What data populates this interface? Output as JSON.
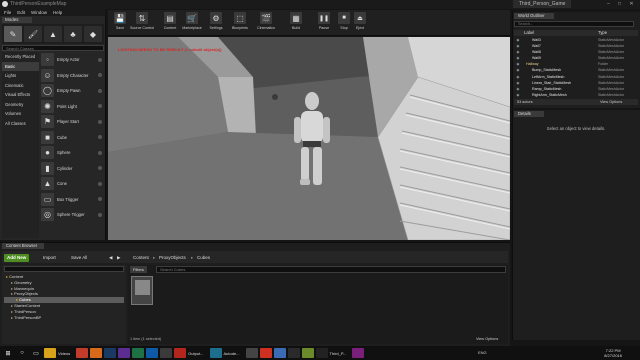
{
  "window": {
    "title": "ThirdPersonExampleMap",
    "project": "Third_Person_Game",
    "menu": [
      "File",
      "Edit",
      "Window",
      "Help"
    ]
  },
  "modes": {
    "tab_label": "Modes",
    "search_placeholder": "Search Classes",
    "icons": [
      "place-icon",
      "paint-icon",
      "landscape-icon",
      "foliage-icon",
      "geometry-icon"
    ],
    "categories": [
      "Recently Placed",
      "Basic",
      "Lights",
      "Cinematic",
      "Visual Effects",
      "Geometry",
      "Volumes",
      "All Classes"
    ],
    "selected_category": "Basic",
    "placeables": [
      "Empty Actor",
      "Empty Character",
      "Empty Pawn",
      "Point Light",
      "Player Start",
      "Cube",
      "Sphere",
      "Cylinder",
      "Cone",
      "Box Trigger",
      "Sphere Trigger"
    ]
  },
  "toolbar": [
    {
      "label": "Save",
      "icon": "save-icon"
    },
    {
      "label": "Source Control",
      "icon": "source-control-icon"
    },
    {
      "label": "Content",
      "icon": "content-icon"
    },
    {
      "label": "Marketplace",
      "icon": "marketplace-icon"
    },
    {
      "label": "Settings",
      "icon": "settings-icon"
    },
    {
      "label": "Blueprints",
      "icon": "blueprints-icon"
    },
    {
      "label": "Cinematics",
      "icon": "cinematics-icon"
    },
    {
      "label": "Build",
      "icon": "build-icon"
    },
    {
      "label": "Pause",
      "icon": "pause-icon"
    },
    {
      "label": "Stop",
      "icon": "stop-icon"
    },
    {
      "label": "Eject",
      "icon": "eject-icon"
    }
  ],
  "viewport": {
    "lighting_message": "LIGHTING NEEDS TO BE REBUILT (1 unbuilt object(s))"
  },
  "outliner": {
    "tab_label": "World Outliner",
    "search_placeholder": "Search...",
    "col_label": "Label",
    "col_type": "Type",
    "rows": [
      {
        "label": "Wall3",
        "type": "StaticMeshActor",
        "folder": false
      },
      {
        "label": "Wall7",
        "type": "StaticMeshActor",
        "folder": false
      },
      {
        "label": "Wall8",
        "type": "StaticMeshActor",
        "folder": false
      },
      {
        "label": "Wall9",
        "type": "StaticMeshActor",
        "folder": false
      },
      {
        "label": "Hallway",
        "type": "Folder",
        "folder": true
      },
      {
        "label": "Bump_StaticMesh",
        "type": "StaticMeshActor",
        "folder": false
      },
      {
        "label": "LeftArm_StaticMesh",
        "type": "StaticMeshActor",
        "folder": false
      },
      {
        "label": "Linear_Stair_StaticMesh",
        "type": "StaticMeshActor",
        "folder": false
      },
      {
        "label": "Ramp_StaticMesh",
        "type": "StaticMeshActor",
        "folder": false
      },
      {
        "label": "RightArm_StaticMesh",
        "type": "StaticMeshActor",
        "folder": false
      },
      {
        "label": "Lighting",
        "type": "Folder",
        "folder": true
      }
    ],
    "actors_count": "53 actors",
    "view_options": "View Options"
  },
  "details": {
    "tab_label": "Details",
    "empty_message": "Select an object to view details."
  },
  "content_browser": {
    "tab_label": "Content Browser",
    "add_new": "Add New",
    "import": "Import",
    "save_all": "Save All",
    "breadcrumb": [
      "Content",
      "ProxyObjects",
      "Cubes"
    ],
    "filters": "Filters",
    "search_placeholder": "Search Cubes",
    "tree": [
      {
        "label": "Content",
        "depth": 0
      },
      {
        "label": "Geometry",
        "depth": 1
      },
      {
        "label": "Mannequin",
        "depth": 1
      },
      {
        "label": "ProxyObjects",
        "depth": 1
      },
      {
        "label": "Cubes",
        "depth": 2
      },
      {
        "label": "StarterContent",
        "depth": 1
      },
      {
        "label": "ThirdPerson",
        "depth": 1
      },
      {
        "label": "ThirdPersonBP",
        "depth": 1
      }
    ],
    "selected_tree": "Cubes",
    "asset_name": "Cube_Mesh",
    "items_count": "1 item (1 selected)",
    "view_options": "View Options"
  },
  "taskbar": {
    "apps": [
      {
        "icon": "windows-start-icon",
        "color": "#101010"
      },
      {
        "icon": "cortana-icon",
        "color": "#101010"
      },
      {
        "icon": "task-view-icon",
        "color": "#101010"
      },
      {
        "icon": "file-explorer-icon",
        "color": "#d9a21b",
        "label": "Videos"
      },
      {
        "icon": "chrome-icon",
        "color": "#c33b2a"
      },
      {
        "icon": "firefox-icon",
        "color": "#d86a1a"
      },
      {
        "icon": "photoshop-icon",
        "color": "#1b3a63"
      },
      {
        "icon": "visual-studio-icon",
        "color": "#5c2d91"
      },
      {
        "icon": "excel-icon",
        "color": "#1e7145"
      },
      {
        "icon": "outlook-icon",
        "color": "#0e5aa7"
      },
      {
        "icon": "app-icon",
        "color": "#3a3a3a"
      },
      {
        "icon": "acrobat-icon",
        "color": "#b3261e",
        "label": "Output..."
      },
      {
        "icon": "autodesk-icon",
        "color": "#1c6e8c",
        "label": "Autode..."
      },
      {
        "icon": "app-icon",
        "color": "#444444"
      },
      {
        "icon": "media-player-icon",
        "color": "#d0301f"
      },
      {
        "icon": "app-icon",
        "color": "#3b6bb5"
      },
      {
        "icon": "app-icon",
        "color": "#2a2a2a"
      },
      {
        "icon": "app-icon",
        "color": "#6b8a2a"
      },
      {
        "icon": "unreal-icon",
        "color": "#222222",
        "label": "Third_P..."
      },
      {
        "icon": "app-icon",
        "color": "#7a1f7a"
      }
    ],
    "tray_lang": "ENG",
    "time": "7:22 PM",
    "date": "8/27/2016"
  },
  "colors": {
    "viewport_wall": "#cfcfcf",
    "accent_green": "#4f8c25",
    "warning_red": "#d02a2a"
  }
}
